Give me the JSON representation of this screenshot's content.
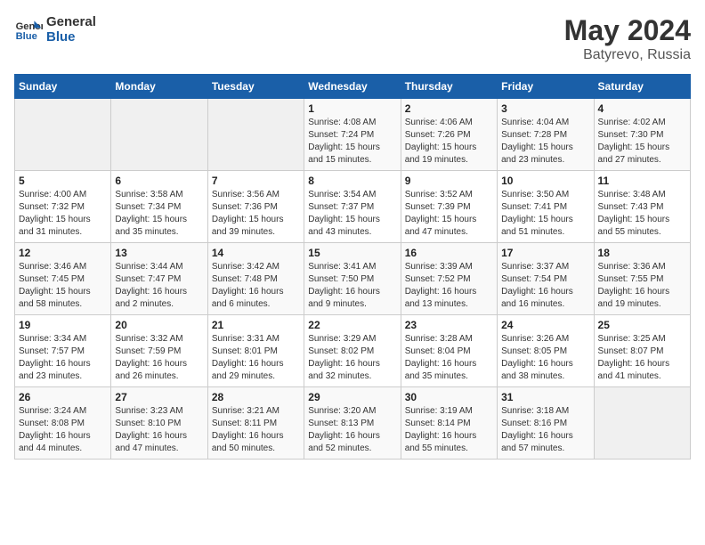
{
  "header": {
    "logo_general": "General",
    "logo_blue": "Blue",
    "title": "May 2024",
    "location": "Batyrevo, Russia"
  },
  "days_of_week": [
    "Sunday",
    "Monday",
    "Tuesday",
    "Wednesday",
    "Thursday",
    "Friday",
    "Saturday"
  ],
  "weeks": [
    [
      {
        "day": "",
        "info": ""
      },
      {
        "day": "",
        "info": ""
      },
      {
        "day": "",
        "info": ""
      },
      {
        "day": "1",
        "info": "Sunrise: 4:08 AM\nSunset: 7:24 PM\nDaylight: 15 hours\nand 15 minutes."
      },
      {
        "day": "2",
        "info": "Sunrise: 4:06 AM\nSunset: 7:26 PM\nDaylight: 15 hours\nand 19 minutes."
      },
      {
        "day": "3",
        "info": "Sunrise: 4:04 AM\nSunset: 7:28 PM\nDaylight: 15 hours\nand 23 minutes."
      },
      {
        "day": "4",
        "info": "Sunrise: 4:02 AM\nSunset: 7:30 PM\nDaylight: 15 hours\nand 27 minutes."
      }
    ],
    [
      {
        "day": "5",
        "info": "Sunrise: 4:00 AM\nSunset: 7:32 PM\nDaylight: 15 hours\nand 31 minutes."
      },
      {
        "day": "6",
        "info": "Sunrise: 3:58 AM\nSunset: 7:34 PM\nDaylight: 15 hours\nand 35 minutes."
      },
      {
        "day": "7",
        "info": "Sunrise: 3:56 AM\nSunset: 7:36 PM\nDaylight: 15 hours\nand 39 minutes."
      },
      {
        "day": "8",
        "info": "Sunrise: 3:54 AM\nSunset: 7:37 PM\nDaylight: 15 hours\nand 43 minutes."
      },
      {
        "day": "9",
        "info": "Sunrise: 3:52 AM\nSunset: 7:39 PM\nDaylight: 15 hours\nand 47 minutes."
      },
      {
        "day": "10",
        "info": "Sunrise: 3:50 AM\nSunset: 7:41 PM\nDaylight: 15 hours\nand 51 minutes."
      },
      {
        "day": "11",
        "info": "Sunrise: 3:48 AM\nSunset: 7:43 PM\nDaylight: 15 hours\nand 55 minutes."
      }
    ],
    [
      {
        "day": "12",
        "info": "Sunrise: 3:46 AM\nSunset: 7:45 PM\nDaylight: 15 hours\nand 58 minutes."
      },
      {
        "day": "13",
        "info": "Sunrise: 3:44 AM\nSunset: 7:47 PM\nDaylight: 16 hours\nand 2 minutes."
      },
      {
        "day": "14",
        "info": "Sunrise: 3:42 AM\nSunset: 7:48 PM\nDaylight: 16 hours\nand 6 minutes."
      },
      {
        "day": "15",
        "info": "Sunrise: 3:41 AM\nSunset: 7:50 PM\nDaylight: 16 hours\nand 9 minutes."
      },
      {
        "day": "16",
        "info": "Sunrise: 3:39 AM\nSunset: 7:52 PM\nDaylight: 16 hours\nand 13 minutes."
      },
      {
        "day": "17",
        "info": "Sunrise: 3:37 AM\nSunset: 7:54 PM\nDaylight: 16 hours\nand 16 minutes."
      },
      {
        "day": "18",
        "info": "Sunrise: 3:36 AM\nSunset: 7:55 PM\nDaylight: 16 hours\nand 19 minutes."
      }
    ],
    [
      {
        "day": "19",
        "info": "Sunrise: 3:34 AM\nSunset: 7:57 PM\nDaylight: 16 hours\nand 23 minutes."
      },
      {
        "day": "20",
        "info": "Sunrise: 3:32 AM\nSunset: 7:59 PM\nDaylight: 16 hours\nand 26 minutes."
      },
      {
        "day": "21",
        "info": "Sunrise: 3:31 AM\nSunset: 8:01 PM\nDaylight: 16 hours\nand 29 minutes."
      },
      {
        "day": "22",
        "info": "Sunrise: 3:29 AM\nSunset: 8:02 PM\nDaylight: 16 hours\nand 32 minutes."
      },
      {
        "day": "23",
        "info": "Sunrise: 3:28 AM\nSunset: 8:04 PM\nDaylight: 16 hours\nand 35 minutes."
      },
      {
        "day": "24",
        "info": "Sunrise: 3:26 AM\nSunset: 8:05 PM\nDaylight: 16 hours\nand 38 minutes."
      },
      {
        "day": "25",
        "info": "Sunrise: 3:25 AM\nSunset: 8:07 PM\nDaylight: 16 hours\nand 41 minutes."
      }
    ],
    [
      {
        "day": "26",
        "info": "Sunrise: 3:24 AM\nSunset: 8:08 PM\nDaylight: 16 hours\nand 44 minutes."
      },
      {
        "day": "27",
        "info": "Sunrise: 3:23 AM\nSunset: 8:10 PM\nDaylight: 16 hours\nand 47 minutes."
      },
      {
        "day": "28",
        "info": "Sunrise: 3:21 AM\nSunset: 8:11 PM\nDaylight: 16 hours\nand 50 minutes."
      },
      {
        "day": "29",
        "info": "Sunrise: 3:20 AM\nSunset: 8:13 PM\nDaylight: 16 hours\nand 52 minutes."
      },
      {
        "day": "30",
        "info": "Sunrise: 3:19 AM\nSunset: 8:14 PM\nDaylight: 16 hours\nand 55 minutes."
      },
      {
        "day": "31",
        "info": "Sunrise: 3:18 AM\nSunset: 8:16 PM\nDaylight: 16 hours\nand 57 minutes."
      },
      {
        "day": "",
        "info": ""
      }
    ]
  ]
}
